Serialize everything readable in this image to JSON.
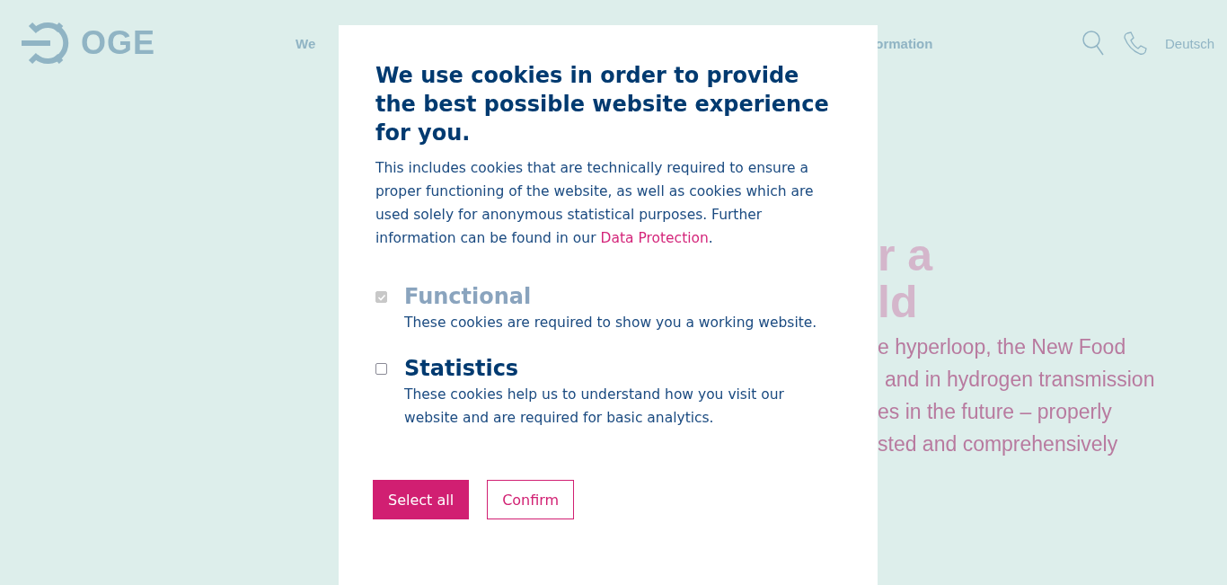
{
  "header": {
    "logo_text": "OGE",
    "nav": [
      "We",
      "ormation"
    ],
    "language": "Deutsch"
  },
  "hero": {
    "title_lines": [
      "r a",
      "ld"
    ],
    "text_lines": [
      "e hyperloop, the New Food",
      "and in hydrogen transmission",
      "es in the future – properly",
      "sted and comprehensively"
    ]
  },
  "cookie_dialog": {
    "title": "We use cookies in order to provide the best possible website experience for you.",
    "intro": "This includes cookies that are technically required to ensure a proper functioning of the website, as well as cookies which are used solely for anonymous statistical purposes. Further information can be found in our",
    "link": "Data Protection",
    "intro_end": ".",
    "options": [
      {
        "title": "Functional",
        "description": "These cookies are required to show you a working website.",
        "checked": true,
        "disabled": true
      },
      {
        "title": "Statistics",
        "description": "These cookies help us to understand how you visit our website and are required for basic analytics.",
        "checked": false,
        "disabled": false
      }
    ],
    "buttons": [
      {
        "label": "Select all",
        "kind": "primary"
      },
      {
        "label": "Confirm",
        "kind": "outline"
      }
    ]
  }
}
